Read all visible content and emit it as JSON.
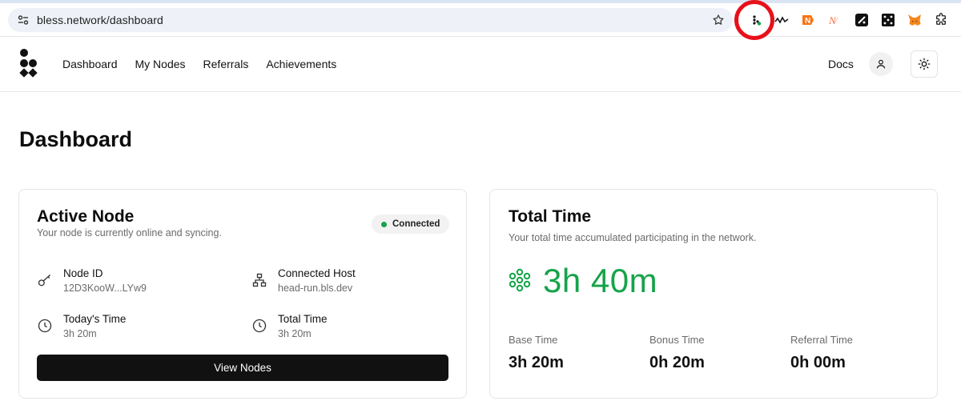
{
  "browser": {
    "url": "bless.network/dashboard"
  },
  "header": {
    "nav": [
      "Dashboard",
      "My Nodes",
      "Referrals",
      "Achievements"
    ],
    "docs": "Docs"
  },
  "page": {
    "title": "Dashboard"
  },
  "active_node": {
    "title": "Active Node",
    "subtitle": "Your node is currently online and syncing.",
    "status": "Connected",
    "status_color": "#16a34a",
    "node_id_label": "Node ID",
    "node_id_value": "12D3KooW...LYw9",
    "host_label": "Connected Host",
    "host_value": "head-run.bls.dev",
    "today_label": "Today's Time",
    "today_value": "3h 20m",
    "total_label": "Total Time",
    "total_value": "3h 20m",
    "button": "View Nodes"
  },
  "total_time": {
    "title": "Total Time",
    "subtitle": "Your total time accumulated participating in the network.",
    "value": "3h 40m",
    "accent": "#16a34a",
    "base_label": "Base Time",
    "base_value": "3h 20m",
    "bonus_label": "Bonus Time",
    "bonus_value": "0h 20m",
    "referral_label": "Referral Time",
    "referral_value": "0h 00m"
  }
}
